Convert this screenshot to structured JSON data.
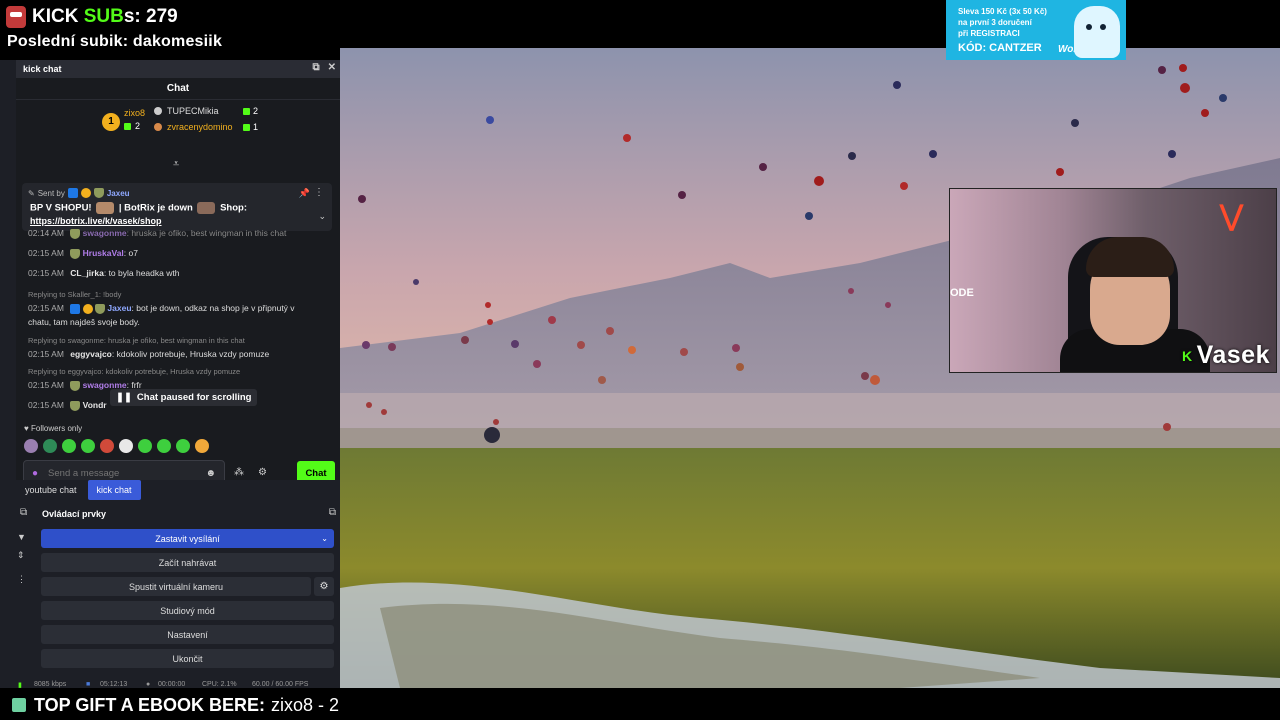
{
  "overlay": {
    "kick_prefix": "KICK ",
    "kick_accent": "SUB",
    "kick_suffix": "s: 279",
    "last_sub": "Poslední subik: dakomesiik"
  },
  "ad": {
    "line1": "Sleva 150 Kč (3x 50 Kč)",
    "line2": "na první 3 doručení",
    "line3": "při REGISTRACI",
    "code": "KÓD: CANTZER",
    "brand": "Wolt"
  },
  "cam": {
    "tag": "ODE",
    "name": "Vasek"
  },
  "dock": {
    "title": "kick chat"
  },
  "chat": {
    "header": "Chat",
    "leaderboard": {
      "first_rank": "1",
      "first_user": "zixo8",
      "first_count": "2",
      "second_user": "TUPECMikia",
      "second_count": "2",
      "third_user": "zvracenydomino",
      "third_count": "1"
    },
    "pinned": {
      "sent_by_label": "Sent by",
      "sent_by_user": "Jaxeu",
      "text_a": "BP V SHOPU!",
      "text_b": "| BotRix je down",
      "text_c": "Shop:",
      "link": "https://botrix.live/k/vasek/shop"
    },
    "messages": [
      {
        "time": "02:14 AM",
        "user": "swagonme",
        "user_color": "#b07de8",
        "text": ": hruska je ofiko, best wingman in this chat"
      },
      {
        "time": "02:15 AM",
        "user": "HruskaVal",
        "user_color": "#b07de8",
        "text": ": o7"
      },
      {
        "time": "02:15 AM",
        "user": "CL_jirka",
        "user_color": "#e6e6e6",
        "text": ": to byla headka wth"
      },
      {
        "time": "02:15 AM",
        "user": "Jaxeu",
        "user_color": "#8fa8ff",
        "text": ": bot je down, odkaz na shop je v připnutý v"
      },
      {
        "time": "",
        "user": "",
        "user_color": "#ddd",
        "text": "chatu, tam najdeš svoje body."
      },
      {
        "time": "02:15 AM",
        "user": "eggyvajco",
        "user_color": "#e6e6e6",
        "text": ": kdokoliv potrebuje, Hruska vzdy pomuze"
      },
      {
        "time": "02:15 AM",
        "user": "swagonme",
        "user_color": "#b07de8",
        "text": ": frfr"
      },
      {
        "time": "02:15 AM",
        "user": "Vondr",
        "user_color": "#e6e6e6",
        "text": ""
      }
    ],
    "replies": [
      "Replying to Skaller_1: !body",
      "Replying to swagonme: hruska je ofiko, best wingman in this chat",
      "Replying to eggyvajco: kdokoliv potrebuje, Hruska vzdy pomuze"
    ],
    "paused": "Chat paused for scrolling",
    "followers_only": "Followers only",
    "send_placeholder": "Send a message",
    "send_button": "Chat"
  },
  "tabs": [
    "youtube chat",
    "kick chat"
  ],
  "controls": {
    "title": "Ovládací prvky",
    "stop_stream": "Zastavit vysílání",
    "start_record": "Začít nahrávat",
    "virtual_cam": "Spustit virtuální kameru",
    "studio_mode": "Studiový mód",
    "settings": "Nastavení",
    "exit": "Ukončit"
  },
  "status": {
    "bitrate": "8085 kbps",
    "live_time": "05:12:13",
    "rec_time": "00:00:00",
    "cpu": "CPU: 2.1%",
    "fps": "60.00 / 60.00 FPS"
  },
  "ticker": {
    "label": "TOP GIFT A EBOOK BERE:",
    "value": "zixo8 - 2"
  }
}
